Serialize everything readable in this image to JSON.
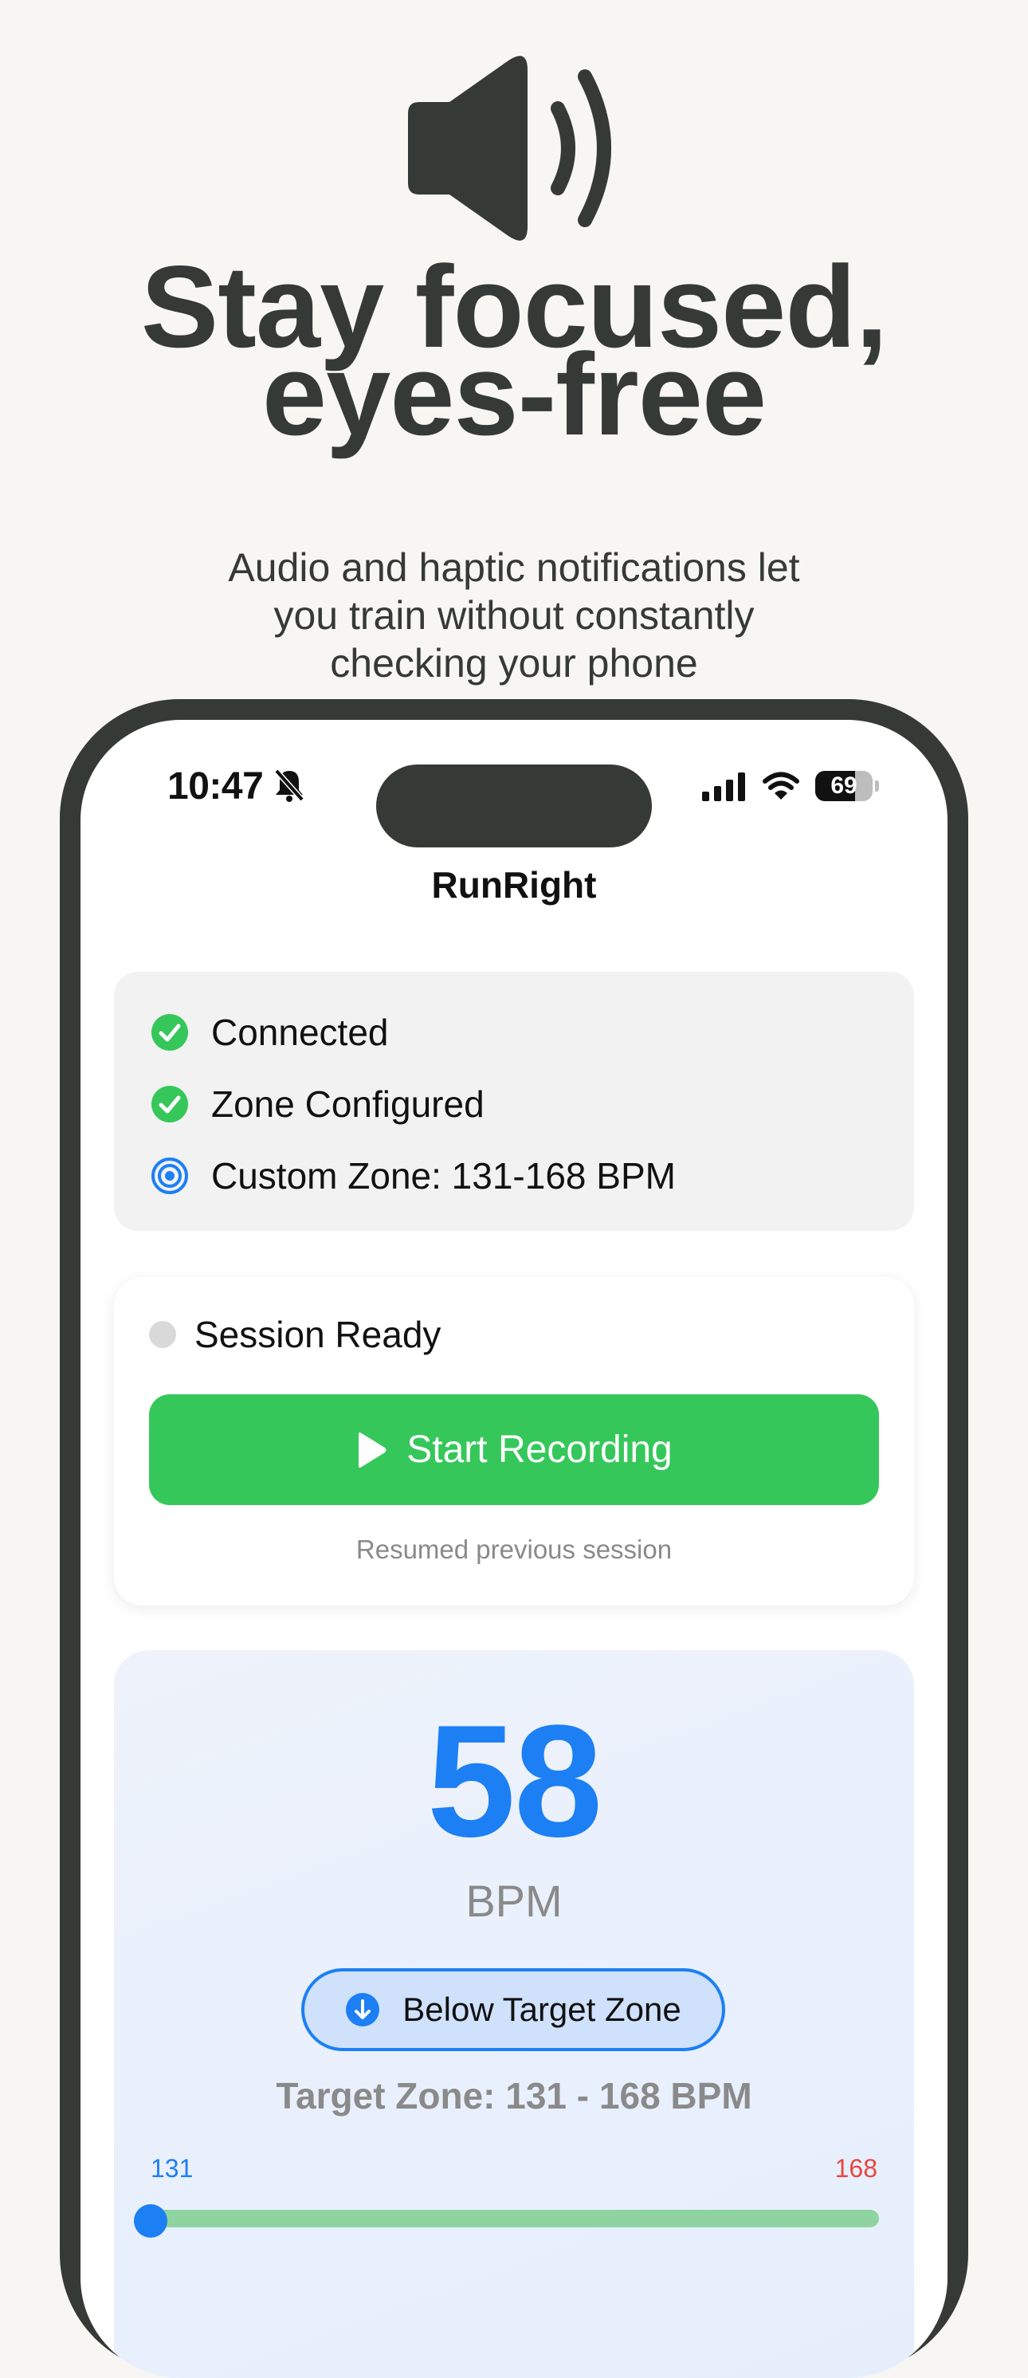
{
  "hero": {
    "icon": "speaker-icon",
    "headline_line1": "Stay focused,",
    "headline_line2": "eyes-free",
    "subtitle_line1": "Audio and haptic notifications let",
    "subtitle_line2": "you train without constantly",
    "subtitle_line3": "checking your phone"
  },
  "statusbar": {
    "time": "10:47",
    "battery": "69",
    "battery_level": 0.69
  },
  "app": {
    "title": "RunRight"
  },
  "status_card": {
    "items": [
      {
        "label": "Connected",
        "icon": "check-circle-icon"
      },
      {
        "label": "Zone Configured",
        "icon": "check-circle-icon"
      },
      {
        "label": "Custom Zone: 131-168 BPM",
        "icon": "target-icon"
      }
    ]
  },
  "session": {
    "status": "Session Ready",
    "start_label": "Start Recording",
    "note": "Resumed previous session"
  },
  "heart_rate": {
    "value": "58",
    "unit": "BPM",
    "zone_status": "Below Target Zone",
    "target_text": "Target Zone: 131 - 168 BPM",
    "min_label": "131",
    "max_label": "168",
    "slider_position": 0.0
  },
  "colors": {
    "accent_blue": "#1d7ff4",
    "green": "#36c75a",
    "red": "#e8473f",
    "dark": "#363a36"
  }
}
